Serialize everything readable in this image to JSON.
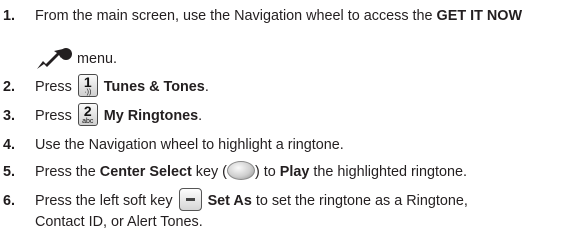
{
  "steps": [
    {
      "number": "1.",
      "pre": "From the main screen, use the Navigation wheel to access the ",
      "bold": "GET IT NOW",
      "continuation": "menu."
    },
    {
      "number": "2.",
      "pre": "Press",
      "key_digit": "1",
      "key_sub": "·))",
      "bold": "Tunes & Tones",
      "post": "."
    },
    {
      "number": "3.",
      "pre": "Press",
      "key_digit": "2",
      "key_sub": "abc",
      "bold": "My Ringtones",
      "post": "."
    },
    {
      "number": "4.",
      "text": "Use the Navigation wheel to highlight a ringtone."
    },
    {
      "number": "5.",
      "pre": "Press the ",
      "bold1": "Center Select",
      "mid1": " key (",
      "mid2": ") to ",
      "bold2": "Play",
      "post": " the highlighted ringtone."
    },
    {
      "number": "6.",
      "pre": "Press the left soft key",
      "bold": "Set As",
      "post": " to set the ringtone as a Ringtone,",
      "continuation": "Contact ID, or Alert Tones."
    }
  ],
  "icons": {
    "get_it_now": "get-it-now-icon",
    "key_1": "keypad-1-icon",
    "key_2": "keypad-2-icon",
    "center_select": "center-select-key-icon",
    "left_soft_key": "left-soft-key-icon"
  }
}
